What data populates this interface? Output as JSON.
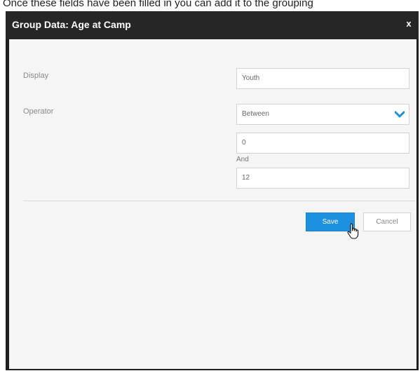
{
  "caption": "Once these fields have been filled in you can add it to the grouping",
  "dialog": {
    "title": "Group Data: Age at Camp",
    "close_label": "x"
  },
  "form": {
    "display": {
      "label": "Display",
      "value": "Youth"
    },
    "operator": {
      "label": "Operator",
      "selected": "Between",
      "from_value": "0",
      "and_label": "And",
      "to_value": "12"
    }
  },
  "actions": {
    "save_label": "Save",
    "cancel_label": "Cancel"
  },
  "icons": {
    "chevron": "chevron-down-icon",
    "cursor": "hand-pointer-icon"
  },
  "colors": {
    "accent": "#1e90e0",
    "titlebar": "#262626",
    "panel": "#f5f5f5"
  }
}
